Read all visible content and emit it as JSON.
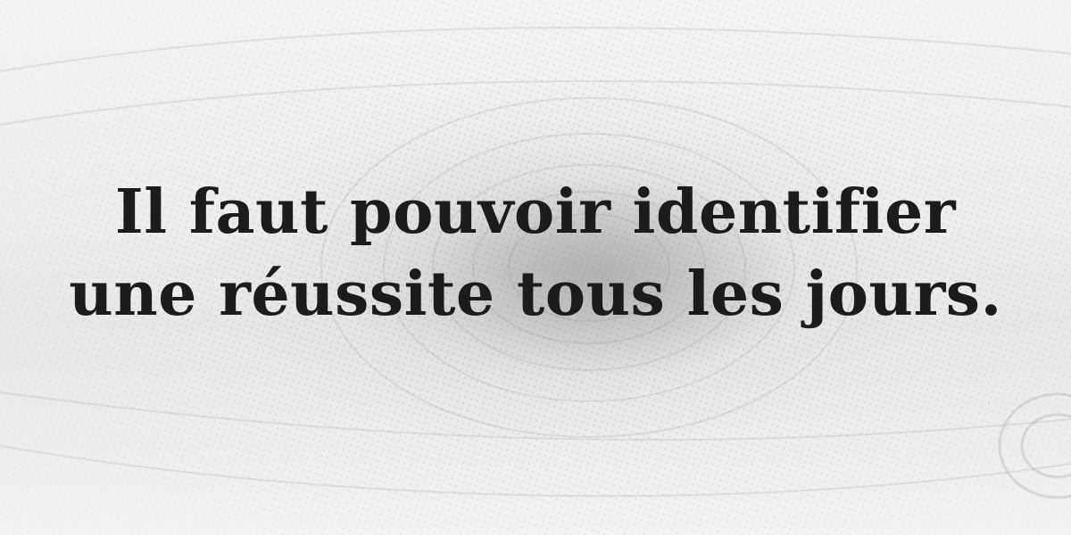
{
  "quote": {
    "line1": "Il faut pouvoir identifier",
    "line2": "une réussite tous les jours."
  },
  "colors": {
    "text": "#1c1c1c",
    "background": "#f2f2f2",
    "texture": "#9a9a9a"
  },
  "background_image": {
    "description_icon": "banknote-engraving-eye"
  }
}
